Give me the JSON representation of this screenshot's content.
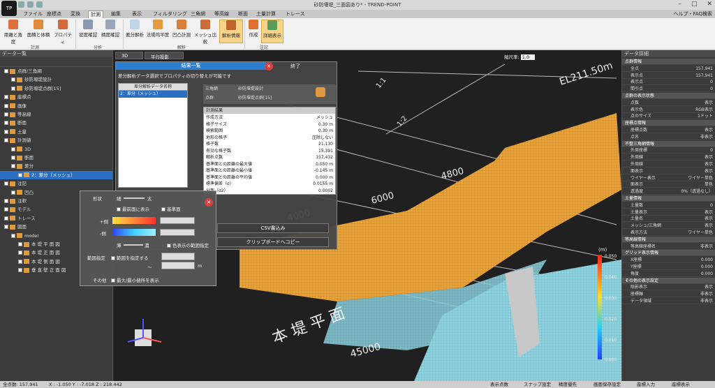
{
  "window": {
    "title": "砂防堰堤_三面図あり* - TREND-POINT",
    "help": "ヘルプ・FAQ検索",
    "app_icon": "TP"
  },
  "menu": [
    "ファイル",
    "座標点",
    "変換",
    "計測",
    "編集",
    "表示",
    "フィルタリング",
    "三角網",
    "等高線",
    "断面",
    "土量計算",
    "トレース"
  ],
  "menu_active": "計測",
  "ribbon": {
    "buttons": [
      {
        "label": "距離と角度",
        "icon": "distance-icon"
      },
      {
        "label": "面積と体積",
        "icon": "area-icon"
      },
      {
        "label": "プロパティ",
        "icon": "property-icon"
      },
      {
        "label": "密度確認",
        "icon": "density-icon"
      },
      {
        "label": "精度確認",
        "icon": "accuracy-icon"
      },
      {
        "label": "差分解析",
        "icon": "diff-icon"
      },
      {
        "label": "法場均平度",
        "icon": "flatness-icon"
      },
      {
        "label": "凹凸計測",
        "icon": "bump-icon"
      },
      {
        "label": "メッシュ比較",
        "icon": "mesh-icon"
      },
      {
        "label": "解析情報",
        "icon": "analysis-icon"
      },
      {
        "label": "作成",
        "icon": "create-icon"
      },
      {
        "label": "詳細表示",
        "icon": "detail-icon"
      }
    ],
    "groups": [
      "計測",
      "分析",
      "解析",
      "注記"
    ]
  },
  "left_panel": {
    "title": "データ一覧",
    "tree": [
      {
        "label": "点群/三角網",
        "level": 0
      },
      {
        "label": "砂防堰堤設計",
        "level": 1
      },
      {
        "label": "砂防堰堤点群[15]",
        "level": 1
      },
      {
        "label": "座標点",
        "level": 0
      },
      {
        "label": "画像",
        "level": 0
      },
      {
        "label": "等高線",
        "level": 0
      },
      {
        "label": "断面",
        "level": 0
      },
      {
        "label": "土量",
        "level": 0
      },
      {
        "label": "計測値",
        "level": 0
      },
      {
        "label": "3D",
        "level": 1
      },
      {
        "label": "断面",
        "level": 1
      },
      {
        "label": "差分",
        "level": 1
      },
      {
        "label": "2：差分（メッシュ）",
        "level": 2,
        "selected": true
      },
      {
        "label": "注記",
        "level": 0
      },
      {
        "label": "凹凸",
        "level": 1
      },
      {
        "label": "注釈",
        "level": 0
      },
      {
        "label": "モデル",
        "level": 0
      },
      {
        "label": "トレース",
        "level": 0
      },
      {
        "label": "図面",
        "level": 0
      },
      {
        "label": "model",
        "level": 1
      },
      {
        "label": "本 堤 平 面 図",
        "level": 2
      },
      {
        "label": "本 堤 正 面 図",
        "level": 2
      },
      {
        "label": "本 堤 側 面 図",
        "level": 2
      },
      {
        "label": "垂 直 壁 正 面 図",
        "level": 2
      }
    ]
  },
  "viewport": {
    "tabs": [
      "3D",
      "平行投影"
    ],
    "scale_label": "縮尺率:",
    "scale_value": "1.0",
    "labels": [
      "EL211.50m",
      "1:1",
      "1:2",
      "4800",
      "6000",
      "4000",
      "本 堤 平 面",
      "45000"
    ],
    "legend_unit": "(m)",
    "legend_ticks": [
      "0.050",
      "0.040",
      "0.030",
      "0.020",
      "0.010",
      "0.000"
    ]
  },
  "result_dialog": {
    "title": "結果一覧",
    "close_label": "終了",
    "desc": "差分解析データ選択でプロパティの切り替えが可能です",
    "list_header": "差分解析データ名称",
    "list_items": [
      "2：差分（メッシュ）"
    ],
    "ref_rows": [
      {
        "k": "三角網",
        "v": "砂防堰堤設計"
      },
      {
        "k": "点群",
        "v": "砂防堰堤点群[15]"
      }
    ],
    "section": "計測結果",
    "props": [
      {
        "k": "作成方法",
        "v": "メッシュ"
      },
      {
        "k": "格子サイズ",
        "v": "0.30 m"
      },
      {
        "k": "検索範囲",
        "v": "0.30 m"
      },
      {
        "k": "地形の格子",
        "v": "圧除しない"
      },
      {
        "k": "格子数",
        "v": "21,130"
      },
      {
        "k": "有効な格子数",
        "v": "15,391"
      },
      {
        "k": "解析点数",
        "v": "157,432"
      },
      {
        "k": "基準面との距離の最大値",
        "v": "0.050 m"
      },
      {
        "k": "基準面との距離の最小値",
        "v": "-0.145 m"
      },
      {
        "k": "基準面との距離の平均値",
        "v": "0.000 m"
      },
      {
        "k": "標準偏差（σ）",
        "v": "0.0155 m"
      },
      {
        "k": "分散（σ2）",
        "v": "0.0002"
      }
    ],
    "csv_button": "CSV書込み",
    "clip_button": "クリップボードへコピー"
  },
  "style_dialog": {
    "shape_label": "形状",
    "thin": "細",
    "thick": "太",
    "show_front": "最前面に表示",
    "base": "基準面",
    "plus": "+側",
    "minus": "-側",
    "opacity_low": "薄",
    "opacity_high": "濃",
    "color_range": "色表示の範囲指定",
    "range_label": "範囲指定",
    "range_check": "範囲を指定する",
    "range_unit": "m",
    "tilde": "～",
    "other_label": "その他",
    "other_check": "最大/最小値所を表示"
  },
  "right_panel": {
    "title": "データ詳細",
    "rows": [
      {
        "k": "点群情報",
        "sec": true
      },
      {
        "k": "全点",
        "v": "157,941"
      },
      {
        "k": "表示点",
        "v": "157,941"
      },
      {
        "k": "表示点",
        "v": "0"
      },
      {
        "k": "間引点",
        "v": "0"
      },
      {
        "k": "点群の表示状態",
        "sec": true
      },
      {
        "k": "点数",
        "v": "表示"
      },
      {
        "k": "表示色",
        "v": "RGB表示"
      },
      {
        "k": "点のサイズ",
        "v": "1ドット"
      },
      {
        "k": "座標点情報",
        "sec": true
      },
      {
        "k": "座標点数",
        "v": "表示"
      },
      {
        "k": "点名",
        "v": "非表示"
      },
      {
        "k": "不整三角網情報",
        "sec": true
      },
      {
        "k": "外周座標",
        "v": "0"
      },
      {
        "k": "外周線",
        "v": "表示"
      },
      {
        "k": "外周線",
        "v": "表示"
      },
      {
        "k": "面表示",
        "v": "表示"
      },
      {
        "k": "ワイヤー表示",
        "v": "ワイヤー単色"
      },
      {
        "k": "面表示",
        "v": "単色"
      },
      {
        "k": "透過度",
        "v": "0%（透過なし）"
      },
      {
        "k": "土量情報",
        "sec": true
      },
      {
        "k": "土量数",
        "v": "0"
      },
      {
        "k": "土量表示",
        "v": "表示"
      },
      {
        "k": "土量名",
        "v": "表示"
      },
      {
        "k": "メッシュ/三角網",
        "v": "表示"
      },
      {
        "k": "表示方法",
        "v": "ワイヤー単色"
      },
      {
        "k": "等高線情報",
        "sec": true
      },
      {
        "k": "等高線座標名",
        "v": "非表示"
      },
      {
        "k": "グリッド表示情報",
        "sec": true
      },
      {
        "k": "X座標",
        "v": "0.000"
      },
      {
        "k": "Y座標",
        "v": "0.000"
      },
      {
        "k": "角度",
        "v": "0.000"
      },
      {
        "k": "その他の表示設定",
        "sec": true
      },
      {
        "k": "陰影表示",
        "v": "表示"
      },
      {
        "k": "座標軸",
        "v": "非表示"
      },
      {
        "k": "データ領域",
        "v": "非表示"
      }
    ]
  },
  "status": {
    "points": "全点数: 157,941",
    "coords": "X : -1.050   Y : -7.018   Z : 218.442",
    "right_items": [
      "表示点数",
      "スナップ設定",
      "精度優先",
      "画面保存設定",
      "座標入力",
      "座標表示"
    ]
  },
  "colors": {
    "accent": "#2d7fd1",
    "mesh_orange": "#e8a43a",
    "mesh_cyan": "#8fd3e0",
    "selected": "#2b6fc2"
  }
}
